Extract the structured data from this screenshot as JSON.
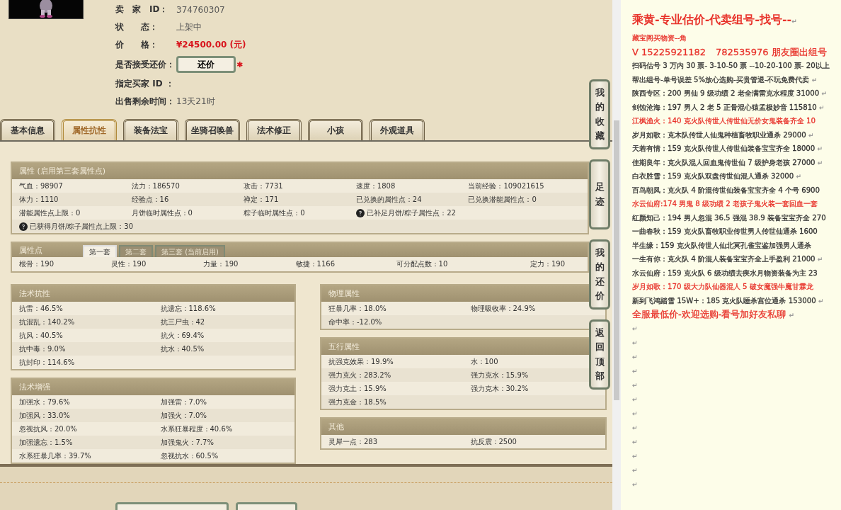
{
  "listing": {
    "rows": [
      {
        "label": "卖　家　ID：",
        "value": "374760307",
        "kind": "text"
      },
      {
        "label": "状　　态：",
        "value": "上架中",
        "kind": "text"
      },
      {
        "label": "价　　格：",
        "value": "¥24500.00 (元)",
        "kind": "price"
      },
      {
        "label": "是否接受还价：",
        "value": "还价",
        "kind": "button",
        "required_mark": "✱"
      },
      {
        "label": "指定买家 ID ：",
        "kind": "text"
      },
      {
        "label": "出售剩余时间：",
        "value": "13天21时",
        "kind": "text"
      }
    ]
  },
  "tabs": [
    {
      "label": "基本信息",
      "selected": false
    },
    {
      "label": "属性抗性",
      "selected": true
    },
    {
      "label": "装备法宝",
      "selected": false
    },
    {
      "label": "坐骑召唤兽",
      "selected": false
    },
    {
      "label": "法术修正",
      "selected": false
    },
    {
      "label": "小孩",
      "selected": false
    },
    {
      "label": "外观道具",
      "selected": false
    }
  ],
  "attributes": {
    "title": "属性 (启用第三套属性点)",
    "rows": [
      [
        {
          "text": "气血：98907"
        },
        {
          "text": "法力：186570"
        },
        {
          "text": "攻击：7731"
        },
        {
          "text": "速度：1808"
        },
        {
          "text": "当前经验：109021615"
        }
      ],
      [
        {
          "text": "体力：1110"
        },
        {
          "text": "经验点：16"
        },
        {
          "text": "禅定：171"
        },
        {
          "text": "已兑换的属性点：24"
        },
        {
          "text": "已兑换潜能属性点：0"
        }
      ],
      [
        {
          "text": "潜能属性点上限：0"
        },
        {
          "text": "月饼临时属性点：0"
        },
        {
          "text": "粽子临时属性点：0"
        },
        {
          "text": "已补足月饼/粽子属性点：22",
          "help": true
        }
      ],
      [
        {
          "text": "已获得月饼/粽子属性点上限：30",
          "help": true
        }
      ]
    ]
  },
  "points": {
    "title": "属性点",
    "subtabs": [
      {
        "label": "第一套",
        "selected": true
      },
      {
        "label": "第二套",
        "selected": false
      },
      {
        "label": "第三套 (当前启用)",
        "selected": false
      }
    ],
    "items": [
      "根骨：190",
      "灵性：190",
      "力量：190",
      "敏捷：1166",
      "可分配点数：10",
      "定力：190"
    ]
  },
  "left_panels": [
    {
      "title": "法术抗性",
      "items": [
        "抗雷：46.5%",
        "抗遗忘：118.6%",
        "抗混乱：140.2%",
        "抗三尸虫：42",
        "抗风：40.5%",
        "抗火：69.4%",
        "抗中毒：9.0%",
        "抗水：40.5%",
        "抗封印：114.6%"
      ]
    },
    {
      "title": "法术增强",
      "items": [
        "加强水：79.6%",
        "加强雷：7.0%",
        "加强风：33.0%",
        "加强火：7.0%",
        "忽视抗风：20.0%",
        "水系狂暴程度：40.6%",
        "加强遗忘：1.5%",
        "加强鬼火：7.7%",
        "水系狂暴几率：39.7%",
        "忽视抗水：60.5%"
      ]
    }
  ],
  "right_panels": [
    {
      "title": "物理属性",
      "items": [
        "狂暴几率：18.0%",
        "物理吸收率：24.9%",
        "命中率：-12.0%"
      ]
    },
    {
      "title": "五行属性",
      "items": [
        "抗强克效果：19.9%",
        "水：100",
        "强力克火：283.2%",
        "强力克水：15.9%",
        "强力克土：15.9%",
        "强力克木：30.2%",
        "强力克金：18.5%"
      ]
    },
    {
      "title": "其他",
      "items": [
        "灵犀一点：283",
        "抗反震：2500"
      ]
    }
  ],
  "side_buttons": [
    "我的收藏",
    "足迹",
    "我的还价",
    "返回顶部"
  ],
  "document": {
    "title": "乘黄-专业估价-代卖组号-找号--",
    "title_mark": "↵",
    "lines": [
      {
        "parts": [
          "藏宝阁买物资--角"
        ],
        "color": "#e8322a"
      },
      {
        "parts": [
          "V 15225921182",
          "782535976 朋友圈出组号"
        ],
        "color": "#e8322a",
        "large": true
      },
      {
        "parts": [
          "扫码估号 3 万内 30 票- 3-10-50 票  --10-20-100 票- 20以上"
        ],
        "color": "#333333"
      },
      {
        "parts": [
          "帮出组号-单号误差 5%放心选购-买贵管退-不玩免费代卖"
        ],
        "color": "#333333",
        "mark": "↵"
      },
      {
        "parts": [
          "陕西专区：200 男仙 9 级功绩 2 老全满雷克水程度 31000"
        ],
        "color": "#333333",
        "mark": "↵"
      },
      {
        "parts": [
          "剑蚀沧海：197 男人 2 老 5 正骨混心猿孟极妙音 115810"
        ],
        "color": "#333333",
        "mark": "↵"
      },
      {
        "parts": [
          "江枫渔火：140 克火队传世人传世仙无价女鬼装备齐全 10"
        ],
        "color": "#e8322a"
      },
      {
        "parts": [
          "岁月如歌：克木队传世人仙鬼种植畜牧职业通杀 29000"
        ],
        "color": "#333333",
        "mark": "↵"
      },
      {
        "parts": [
          "天若有情：159 克火队传世人传世仙装备宝宝齐全 18000"
        ],
        "color": "#333333",
        "mark": "↵"
      },
      {
        "parts": [
          "佳期良年：克火队混人回血鬼传世仙 7 级护身老孩 27000"
        ],
        "color": "#333333",
        "mark": "↵"
      },
      {
        "parts": [
          "白衣胜雪：159 克火队双盘传世仙混人通杀 32000"
        ],
        "color": "#333333",
        "mark": "↵"
      },
      {
        "parts": [
          "百鸟朝凤：克火队 4 阶混传世仙装备宝宝齐全 4 个号 6900"
        ],
        "color": "#333333"
      },
      {
        "parts": [
          "水云仙府:174 男鬼 8 级功绩 2 老孩子鬼火装一套回血一套"
        ],
        "color": "#e8322a"
      },
      {
        "parts": [
          "红颜知己：194 男人忽混 36.5 强混 38.9 装备宝宝齐全 270"
        ],
        "color": "#333333"
      },
      {
        "parts": [
          "一曲春秋：159 克火队畜牧职业传世男人传世仙通杀 1600"
        ],
        "color": "#333333"
      },
      {
        "parts": [
          "半生缘：159 克火队传世人仙北冥孔雀宝鉴加强男人通杀"
        ],
        "color": "#333333"
      },
      {
        "parts": [
          "一生有你：克火队 4 阶混人装备宝宝齐全上手盈利 21000"
        ],
        "color": "#333333",
        "mark": "↵"
      },
      {
        "parts": [
          "水云仙府：159 克火队 6 级功绩去疾水月物资装备为主 23"
        ],
        "color": "#333333"
      },
      {
        "parts": [
          "岁月如歌：170 级大力队仙器混人 5 破女魔强牛魔甘霖龙"
        ],
        "color": "#e8322a"
      },
      {
        "parts": [
          "新到飞鸿踏雪 15W+：185 克火队睡杀宫位通杀 153000"
        ],
        "color": "#333333",
        "mark": "↵"
      },
      {
        "parts": [
          "全服最低价-欢迎选购-看号加好友私聊"
        ],
        "color": "#e8322a",
        "large": true,
        "mark": "↵"
      }
    ],
    "empty_paragraphs": [
      "↵",
      "↵",
      "↵",
      "↵",
      "↵",
      "↵",
      "↵",
      "↵",
      "↵",
      "↵",
      "↵",
      "↵"
    ]
  }
}
